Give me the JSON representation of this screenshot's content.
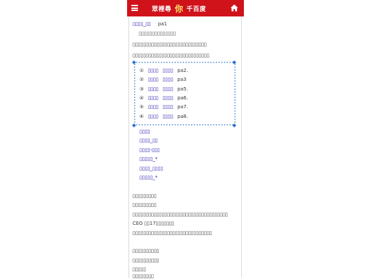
{
  "header": {
    "logo_left": "眾裡尋",
    "logo_mid": "你",
    "logo_right": "千百度"
  },
  "content": {
    "title_link": "▯▯▯▯_▯▯",
    "title_page": "pa1",
    "subtitle": "▯▯▯▯▯▯▯▯▯▯▯▯▯▯",
    "para1": "▯▯▯▯▯▯▯▯▯▯▯▯▯▯▯▯▯▯▯▯▯▯▯▯▯▯▯▯",
    "para2": "▯▯▯▯▯▯▯▯▯▯▯▯▯▯▯▯▯▯▯▯▯▯▯▯▯▯▯▯▯",
    "list": [
      {
        "num": "①",
        "a": "▯▯▯▯",
        "b": "▯▯▯▯",
        "page": "pa2."
      },
      {
        "num": "②",
        "a": "▯▯▯▯",
        "b": "▯▯▯▯",
        "page": "pa3"
      },
      {
        "num": "③",
        "a": "▯▯▯▯",
        "b": "▯▯▯▯",
        "page": "pa5."
      },
      {
        "num": "④",
        "a": "▯▯▯▯",
        "b": "▯▯▯▯",
        "page": "pa6."
      },
      {
        "num": "⑤",
        "a": "▯▯▯▯",
        "b": "▯▯▯▯",
        "page": "pa7."
      },
      {
        "num": "⑥",
        "a": "▯▯▯▯",
        "b": "▯▯▯▯",
        "page": "pa8."
      }
    ],
    "links": [
      "▯▯▯▯",
      "▯▯▯▯_▯▯",
      "▯▯▯▯-▯▯▯",
      "▯▯▯▯▯_*",
      "▯▯▯▯_▯▯▯▯",
      "▯▯▯▯▯_*"
    ],
    "text_rows": [
      "▯▯▯▯▯▯▯▯▯",
      "▯▯▯▯▯▯▯▯▯",
      "▯▯▯▯▯▯▯▯▯▯▯▯▯▯▯▯▯▯▯▯▯▯▯▯▯▯▯▯▯▯▯▯▯▯▯▯",
      "CEO ▯▯17▯▯▯▯▯▯▯",
      "▯▯▯▯▯▯▯▯▯▯▯▯▯▯▯▯▯▯▯▯▯▯▯▯▯▯▯▯▯▯",
      "",
      "▯▯▯▯▯▯▯▯▯▯",
      "▯▯▯▯▯▯▯▯▯▯",
      "▯▯▯▯▯",
      "▯▯▯▯▯▯▯▯"
    ]
  }
}
